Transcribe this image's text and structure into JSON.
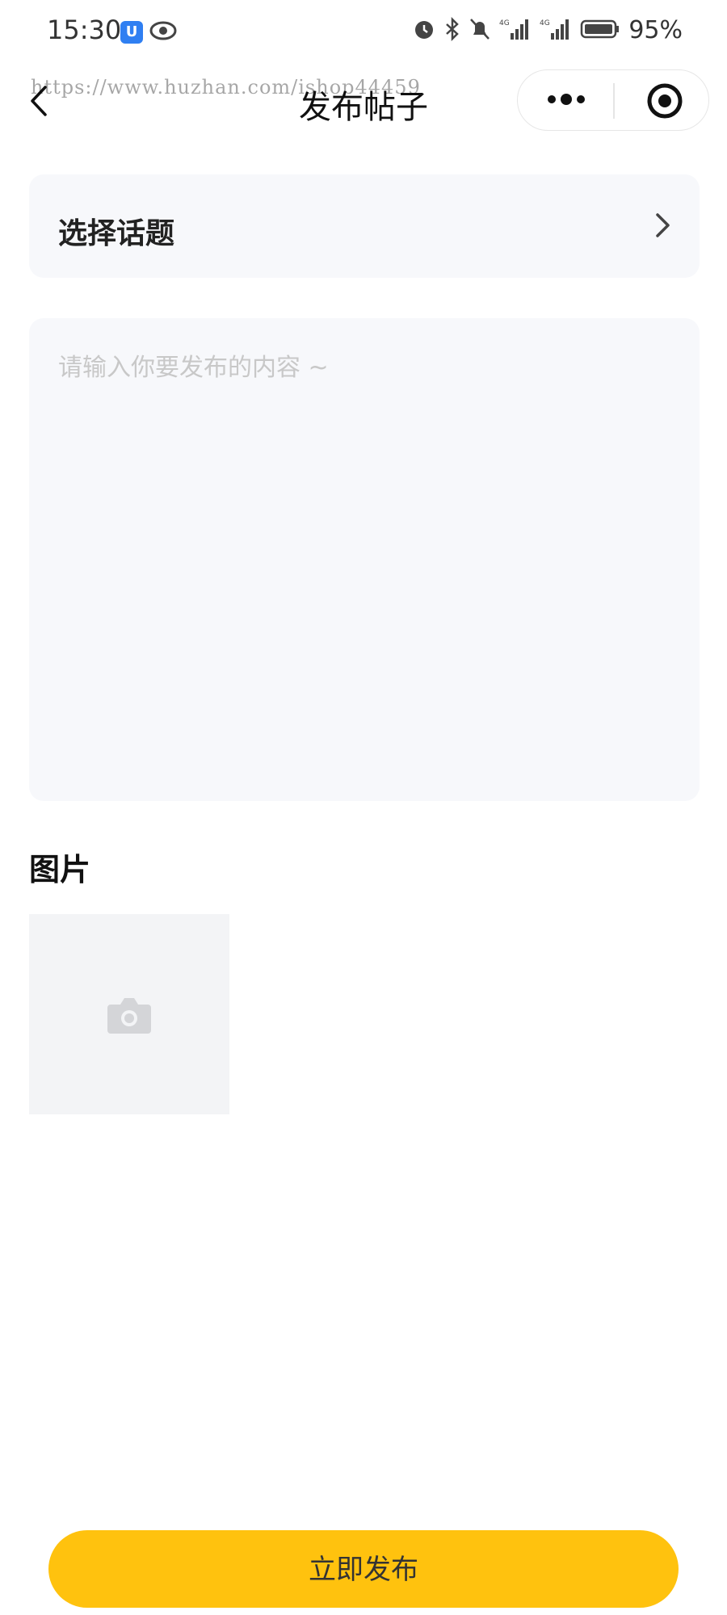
{
  "status_bar": {
    "time": "15:30",
    "app_badge": "U",
    "battery": "95%"
  },
  "nav": {
    "title": "发布帖子",
    "watermark": "https://www.huzhan.com/ishop44459"
  },
  "topic": {
    "label": "选择话题"
  },
  "content": {
    "placeholder": "请输入你要发布的内容 ~",
    "value": ""
  },
  "images": {
    "title": "图片"
  },
  "actions": {
    "publish_label": "立即发布"
  },
  "colors": {
    "accent": "#ffc20e",
    "panel_bg": "#f7f8fb",
    "image_slot_bg": "#f3f4f6"
  }
}
